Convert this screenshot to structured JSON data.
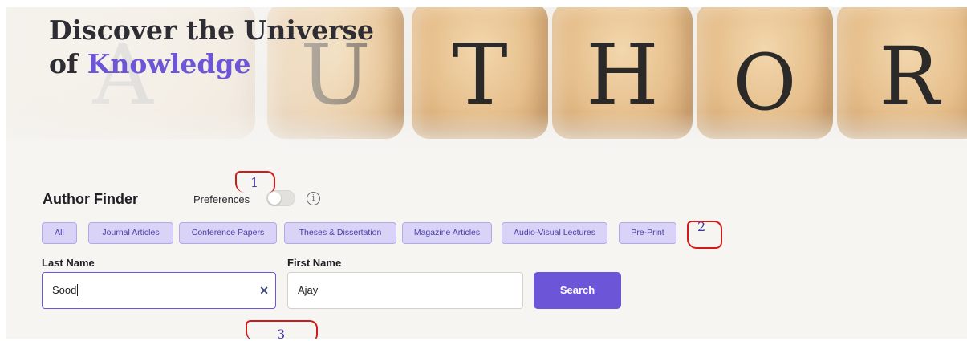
{
  "hero": {
    "title_line1": "Discover the Universe",
    "title_line2_prefix": "of ",
    "title_accent": "Knowledge",
    "background_letters": [
      "A",
      "U",
      "T",
      "H",
      "O",
      "R"
    ]
  },
  "finder": {
    "title": "Author Finder",
    "preferences_label": "Preferences",
    "preferences_enabled": false,
    "info_icon": "info-icon"
  },
  "filters": [
    "All",
    "Journal Articles",
    "Conference Papers",
    "Theses & Dissertation",
    "Magazine Articles",
    "Audio-Visual Lectures",
    "Pre-Print"
  ],
  "form": {
    "last_name_label": "Last Name",
    "last_name_value": "Sood",
    "first_name_label": "First Name",
    "first_name_value": "Ajay",
    "clear_icon": "close-icon",
    "search_label": "Search"
  },
  "annotations": [
    "1",
    "2",
    "3"
  ],
  "colors": {
    "accent": "#6d55d8",
    "chip_bg": "#d9d3f7",
    "annotation_red": "#d11b1b"
  }
}
